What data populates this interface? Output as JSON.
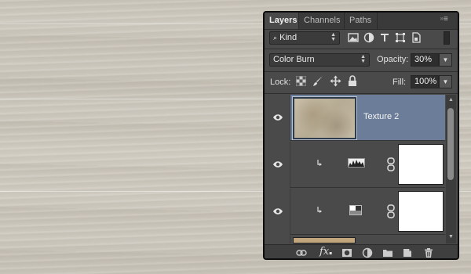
{
  "tabs": [
    {
      "label": "Layers",
      "active": true
    },
    {
      "label": "Channels",
      "active": false
    },
    {
      "label": "Paths",
      "active": false
    }
  ],
  "filter": {
    "kind_label": "Kind"
  },
  "blend": {
    "mode": "Color Burn",
    "opacity_label": "Opacity:",
    "opacity_value": "30%"
  },
  "lock": {
    "label": "Lock:",
    "fill_label": "Fill:",
    "fill_value": "100%"
  },
  "layers": [
    {
      "name": "Texture 2",
      "selected": true,
      "visible": true
    },
    {
      "name": "",
      "type": "levels-adjustment",
      "clipped": true,
      "visible": true
    },
    {
      "name": "",
      "type": "gradient-map-adjustment",
      "clipped": true,
      "visible": true
    }
  ],
  "colors": {
    "panel_bg": "#4a4a4a",
    "selected_layer": "#6b7d99",
    "background_wood": "#cdc8bd"
  },
  "footer_icons": [
    "link-icon",
    "fx-icon",
    "mask-icon",
    "adjustment-icon",
    "folder-icon",
    "new-layer-icon",
    "trash-icon"
  ]
}
